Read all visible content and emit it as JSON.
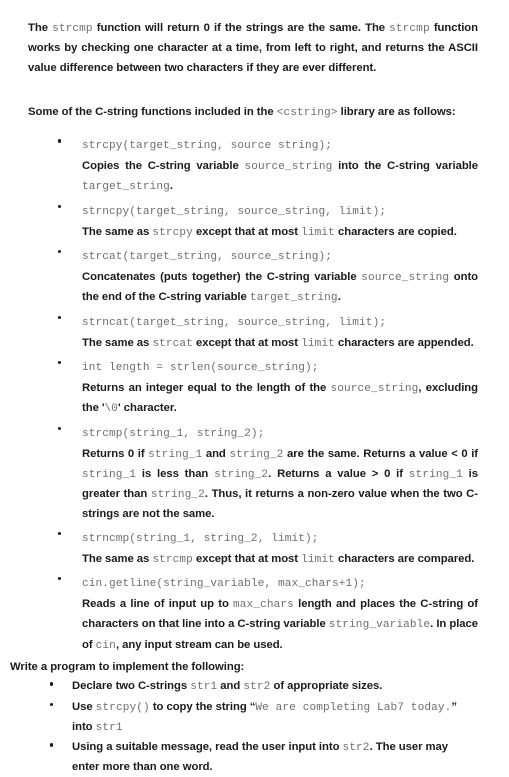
{
  "document": {
    "intro_paragraph": {
      "seg1": "The ",
      "code1": "strcmp",
      "seg2": " function will return 0 if the strings are the same. The ",
      "code2": "strcmp",
      "seg3": " function works by checking one character at a time, from left to right, and returns the ASCII value difference between two characters if they are ever different."
    },
    "library_lead": {
      "seg1": "Some of the C-string functions included in the ",
      "code1": "<cstring>",
      "seg2": " library are as follows:"
    },
    "functions": [
      {
        "signature": "strcpy(target_string, source string);",
        "description_parts": [
          {
            "type": "text",
            "value": "Copies the C-string variable "
          },
          {
            "type": "code",
            "value": "source_string"
          },
          {
            "type": "text",
            "value": " into the C-string variable "
          },
          {
            "type": "code",
            "value": "target_string"
          },
          {
            "type": "text",
            "value": "."
          }
        ]
      },
      {
        "signature": "strncpy(target_string, source_string, limit);",
        "description_parts": [
          {
            "type": "text",
            "value": "The same as "
          },
          {
            "type": "code",
            "value": "strcpy"
          },
          {
            "type": "text",
            "value": " except that at most "
          },
          {
            "type": "code",
            "value": "limit"
          },
          {
            "type": "text",
            "value": " characters are copied."
          }
        ]
      },
      {
        "signature": "strcat(target_string, source_string);",
        "description_parts": [
          {
            "type": "text",
            "value": "Concatenates (puts together) the C-string variable "
          },
          {
            "type": "code",
            "value": "source_string"
          },
          {
            "type": "text",
            "value": " onto the end of the C-string variable "
          },
          {
            "type": "code",
            "value": "target_string"
          },
          {
            "type": "text",
            "value": "."
          }
        ]
      },
      {
        "signature": "strncat(target_string, source_string, limit);",
        "description_parts": [
          {
            "type": "text",
            "value": "The same as "
          },
          {
            "type": "code",
            "value": "strcat"
          },
          {
            "type": "text",
            "value": " except that at most "
          },
          {
            "type": "code",
            "value": "limit"
          },
          {
            "type": "text",
            "value": " characters are appended."
          }
        ]
      },
      {
        "signature": "int length = strlen(source_string);",
        "description_parts": [
          {
            "type": "text",
            "value": "Returns an integer equal to the length of the "
          },
          {
            "type": "code",
            "value": "source_string"
          },
          {
            "type": "text",
            "value": ", excluding the '"
          },
          {
            "type": "code",
            "value": "\\0"
          },
          {
            "type": "text",
            "value": "' character."
          }
        ]
      },
      {
        "signature": "strcmp(string_1, string_2);",
        "description_parts": [
          {
            "type": "text",
            "value": "Returns 0 if "
          },
          {
            "type": "code",
            "value": "string_1"
          },
          {
            "type": "text",
            "value": " and "
          },
          {
            "type": "code",
            "value": "string_2"
          },
          {
            "type": "text",
            "value": " are the same. Returns a value < 0 if "
          },
          {
            "type": "code",
            "value": "string_1"
          },
          {
            "type": "text",
            "value": " is less than "
          },
          {
            "type": "code",
            "value": "string_2"
          },
          {
            "type": "text",
            "value": ". Returns a value > 0 if "
          },
          {
            "type": "code",
            "value": "string_1"
          },
          {
            "type": "text",
            "value": " is greater than "
          },
          {
            "type": "code",
            "value": "string_2"
          },
          {
            "type": "text",
            "value": ". Thus, it returns a non-zero value when the two C-strings are not the same."
          }
        ]
      },
      {
        "signature": "strncmp(string_1, string_2, limit);",
        "description_parts": [
          {
            "type": "text",
            "value": "The same as "
          },
          {
            "type": "code",
            "value": "strcmp"
          },
          {
            "type": "text",
            "value": " except that at most "
          },
          {
            "type": "code",
            "value": "limit"
          },
          {
            "type": "text",
            "value": " characters are compared."
          }
        ]
      },
      {
        "signature": "cin.getline(string_variable, max_chars+1);",
        "description_parts": [
          {
            "type": "text",
            "value": "Reads a line of input up to "
          },
          {
            "type": "code",
            "value": "max_chars"
          },
          {
            "type": "text",
            "value": " length and places the C-string of characters on that line into a C-string variable "
          },
          {
            "type": "code",
            "value": "string_variable"
          },
          {
            "type": "text",
            "value": ". In place of "
          },
          {
            "type": "code",
            "value": "cin"
          },
          {
            "type": "text",
            "value": ", any input stream can be used."
          }
        ]
      }
    ],
    "assignment_lead": "Write a program to implement the following:",
    "assignment_tasks": [
      {
        "parts": [
          {
            "type": "text",
            "value": "Declare two C-strings "
          },
          {
            "type": "code",
            "value": "str1"
          },
          {
            "type": "text",
            "value": " and "
          },
          {
            "type": "code",
            "value": "str2"
          },
          {
            "type": "text",
            "value": " of appropriate sizes."
          }
        ]
      },
      {
        "parts": [
          {
            "type": "text",
            "value": "Use "
          },
          {
            "type": "code",
            "value": "strcpy()"
          },
          {
            "type": "text",
            "value": " to copy the string “"
          },
          {
            "type": "code",
            "value": "We are completing Lab7 today."
          },
          {
            "type": "text",
            "value": "” into "
          },
          {
            "type": "code",
            "value": "str1"
          }
        ]
      },
      {
        "parts": [
          {
            "type": "text",
            "value": "Using a suitable message, read the user input into "
          },
          {
            "type": "code",
            "value": "str2"
          },
          {
            "type": "text",
            "value": ".  The user may enter more than one word."
          }
        ]
      }
    ]
  },
  "colors": {
    "page_background": "#ffffff",
    "body_text": "#1b1b1b",
    "code_text": "#6e6e6e",
    "bullet": "#1b1b1b"
  }
}
